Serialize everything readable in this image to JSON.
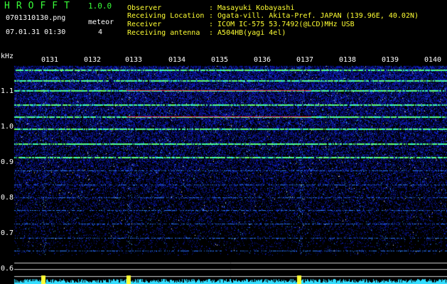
{
  "app": {
    "title": "HROFFT",
    "version": "1.0.0",
    "filename": "0701310130.png",
    "datetime": "07.01.31 01:30",
    "meteor_label": "meteor",
    "meteor_count": "4"
  },
  "info": {
    "observer_label": "Observer",
    "observer_value": ": Masayuki Kobayashi",
    "location_label": "Receiving Location",
    "location_value": ": Ogata-vill. Akita-Pref. JAPAN (139.96E, 40.02N)",
    "receiver_label": "Receiver",
    "receiver_value": ": ICOM IC-575 53.7492(@LCD)MHz USB",
    "antenna_label": "Receiving antenna",
    "antenna_value": ": A504HB(yagi 4el)"
  },
  "colors": {
    "title": "#39ff39",
    "info": "#ffff33",
    "background": "#000000",
    "noise": "#1a2cff",
    "trace": "#33ffcc",
    "meteor_echo": "#ff3355",
    "grid": "#cfcfcf",
    "power_bar": "#33ddff"
  },
  "chart_data": {
    "type": "heatmap",
    "ylabel": "kHz",
    "y_ticks": [
      "1.1",
      "1.0",
      "0.9",
      "0.8",
      "0.7",
      "0.6"
    ],
    "ylim": [
      0.58,
      1.17
    ],
    "time_ticks": [
      "0131",
      "0132",
      "0133",
      "0134",
      "0135",
      "0136",
      "0137",
      "0138",
      "0139",
      "0140"
    ],
    "traces_khz": [
      1.16,
      1.13,
      1.101,
      1.062,
      1.029,
      0.994,
      0.952,
      0.914,
      0.877,
      0.838,
      0.802,
      0.765,
      0.727,
      0.688,
      0.652
    ],
    "meteor_echo_times": [
      "0131",
      "0133",
      "0137"
    ]
  }
}
